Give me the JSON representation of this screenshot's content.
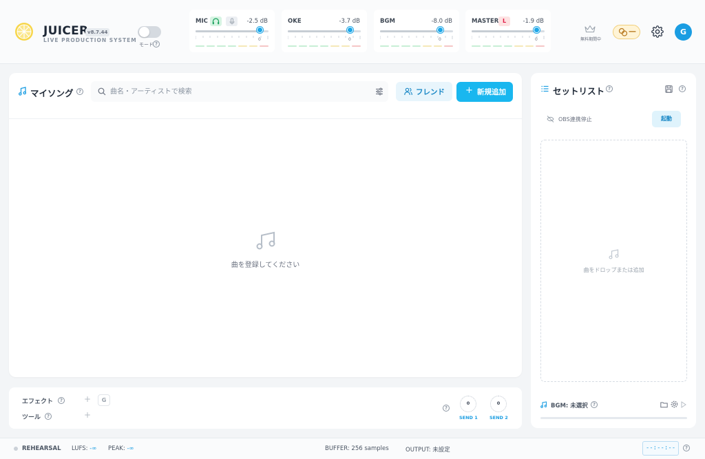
{
  "app": {
    "name": "JUICER",
    "version": "v8.7.44",
    "subtitle": "LIVE PRODUCTION SYSTEM",
    "mode_label": "モード",
    "help": "?"
  },
  "meters": [
    {
      "name": "MIC",
      "db": "-2.5 dB",
      "level": 0.88
    },
    {
      "name": "OKE",
      "db": "-3.7 dB",
      "level": 0.85
    },
    {
      "name": "BGM",
      "db": "-8.0 dB",
      "level": 0.82
    },
    {
      "name": "MASTER",
      "db": "-1.9 dB",
      "level": 0.89,
      "chip": "L"
    }
  ],
  "meter_zero": "0",
  "header_right": {
    "trial_label": "無料期間中",
    "coin_value": "—",
    "avatar_letter": "G"
  },
  "my_songs": {
    "title": "マイソング",
    "search_placeholder": "曲名・アーティストで検索",
    "friends_label": "フレンド",
    "add_label": "新規追加",
    "add_plus": "+",
    "empty_text": "曲を登録してください"
  },
  "effects": {
    "effect_label": "エフェクト",
    "tool_label": "ツール",
    "add_symbol": "+",
    "effect_chip": "G",
    "sends": [
      {
        "label": "SEND 1",
        "value": "0"
      },
      {
        "label": "SEND 2",
        "value": "0"
      }
    ]
  },
  "setlist": {
    "title": "セットリスト",
    "obs_label": "OBS連携停止",
    "obs_start": "起動",
    "drop_text": "曲をドロップまたは追加",
    "bgm_label": "BGM: 未選択"
  },
  "status": {
    "mode": "REHEARSAL",
    "lufs_label": "LUFS:",
    "lufs_value": "-∞",
    "peak_label": "PEAK:",
    "peak_value": "-∞",
    "buffer": "BUFFER: 256 samples",
    "output": "OUTPUT: 未設定",
    "timecode": "--:--:--"
  },
  "colors": {
    "accent": "#19b7ef",
    "accent_dark": "#1686c5",
    "logo": "#f7d64a"
  }
}
